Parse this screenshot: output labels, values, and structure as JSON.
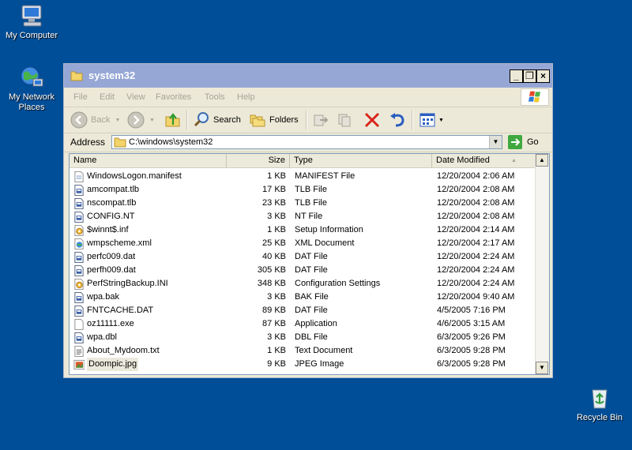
{
  "desktop": {
    "icons": [
      {
        "label": "My Computer"
      },
      {
        "label": "My Network Places"
      },
      {
        "label": "Recycle Bin"
      }
    ]
  },
  "window": {
    "title": "system32",
    "controls": {
      "minimize": "_",
      "restore": "❐",
      "close": "×"
    }
  },
  "menu": [
    "File",
    "Edit",
    "View",
    "Favorites",
    "Tools",
    "Help"
  ],
  "toolbar": {
    "back": "Back",
    "search": "Search",
    "folders": "Folders"
  },
  "address": {
    "label": "Address",
    "value": "C:\\windows\\system32",
    "go": "Go"
  },
  "columns": {
    "name": "Name",
    "size": "Size",
    "type": "Type",
    "date": "Date Modified"
  },
  "files": [
    {
      "name": "WindowsLogon.manifest",
      "size": "1 KB",
      "type": "MANIFEST File",
      "date": "12/20/2004 2:06 AM",
      "icon": "generic-file-icon"
    },
    {
      "name": "amcompat.tlb",
      "size": "17 KB",
      "type": "TLB File",
      "date": "12/20/2004 2:08 AM",
      "icon": "system-file-icon"
    },
    {
      "name": "nscompat.tlb",
      "size": "23 KB",
      "type": "TLB File",
      "date": "12/20/2004 2:08 AM",
      "icon": "system-file-icon"
    },
    {
      "name": "CONFIG.NT",
      "size": "3 KB",
      "type": "NT File",
      "date": "12/20/2004 2:08 AM",
      "icon": "system-file-icon"
    },
    {
      "name": "$winnt$.inf",
      "size": "1 KB",
      "type": "Setup Information",
      "date": "12/20/2004 2:14 AM",
      "icon": "setup-file-icon"
    },
    {
      "name": "wmpscheme.xml",
      "size": "25 KB",
      "type": "XML Document",
      "date": "12/20/2004 2:17 AM",
      "icon": "xml-file-icon"
    },
    {
      "name": "perfc009.dat",
      "size": "40 KB",
      "type": "DAT File",
      "date": "12/20/2004 2:24 AM",
      "icon": "system-file-icon"
    },
    {
      "name": "perfh009.dat",
      "size": "305 KB",
      "type": "DAT File",
      "date": "12/20/2004 2:24 AM",
      "icon": "system-file-icon"
    },
    {
      "name": "PerfStringBackup.INI",
      "size": "348 KB",
      "type": "Configuration Settings",
      "date": "12/20/2004 2:24 AM",
      "icon": "setup-file-icon"
    },
    {
      "name": "wpa.bak",
      "size": "3 KB",
      "type": "BAK File",
      "date": "12/20/2004 9:40 AM",
      "icon": "system-file-icon"
    },
    {
      "name": "FNTCACHE.DAT",
      "size": "89 KB",
      "type": "DAT File",
      "date": "4/5/2005 7:16 PM",
      "icon": "system-file-icon"
    },
    {
      "name": "oz11111.exe",
      "size": "87 KB",
      "type": "Application",
      "date": "4/6/2005 3:15 AM",
      "icon": "application-icon"
    },
    {
      "name": "wpa.dbl",
      "size": "3 KB",
      "type": "DBL File",
      "date": "6/3/2005 9:26 PM",
      "icon": "system-file-icon"
    },
    {
      "name": "About_Mydoom.txt",
      "size": "1 KB",
      "type": "Text Document",
      "date": "6/3/2005 9:28 PM",
      "icon": "text-file-icon"
    },
    {
      "name": "Doompic.jpg",
      "size": "9 KB",
      "type": "JPEG Image",
      "date": "6/3/2005 9:28 PM",
      "icon": "jpeg-image-icon"
    }
  ],
  "colors": {
    "desktop": "#004e98",
    "titlebar": "#96a7d6"
  }
}
